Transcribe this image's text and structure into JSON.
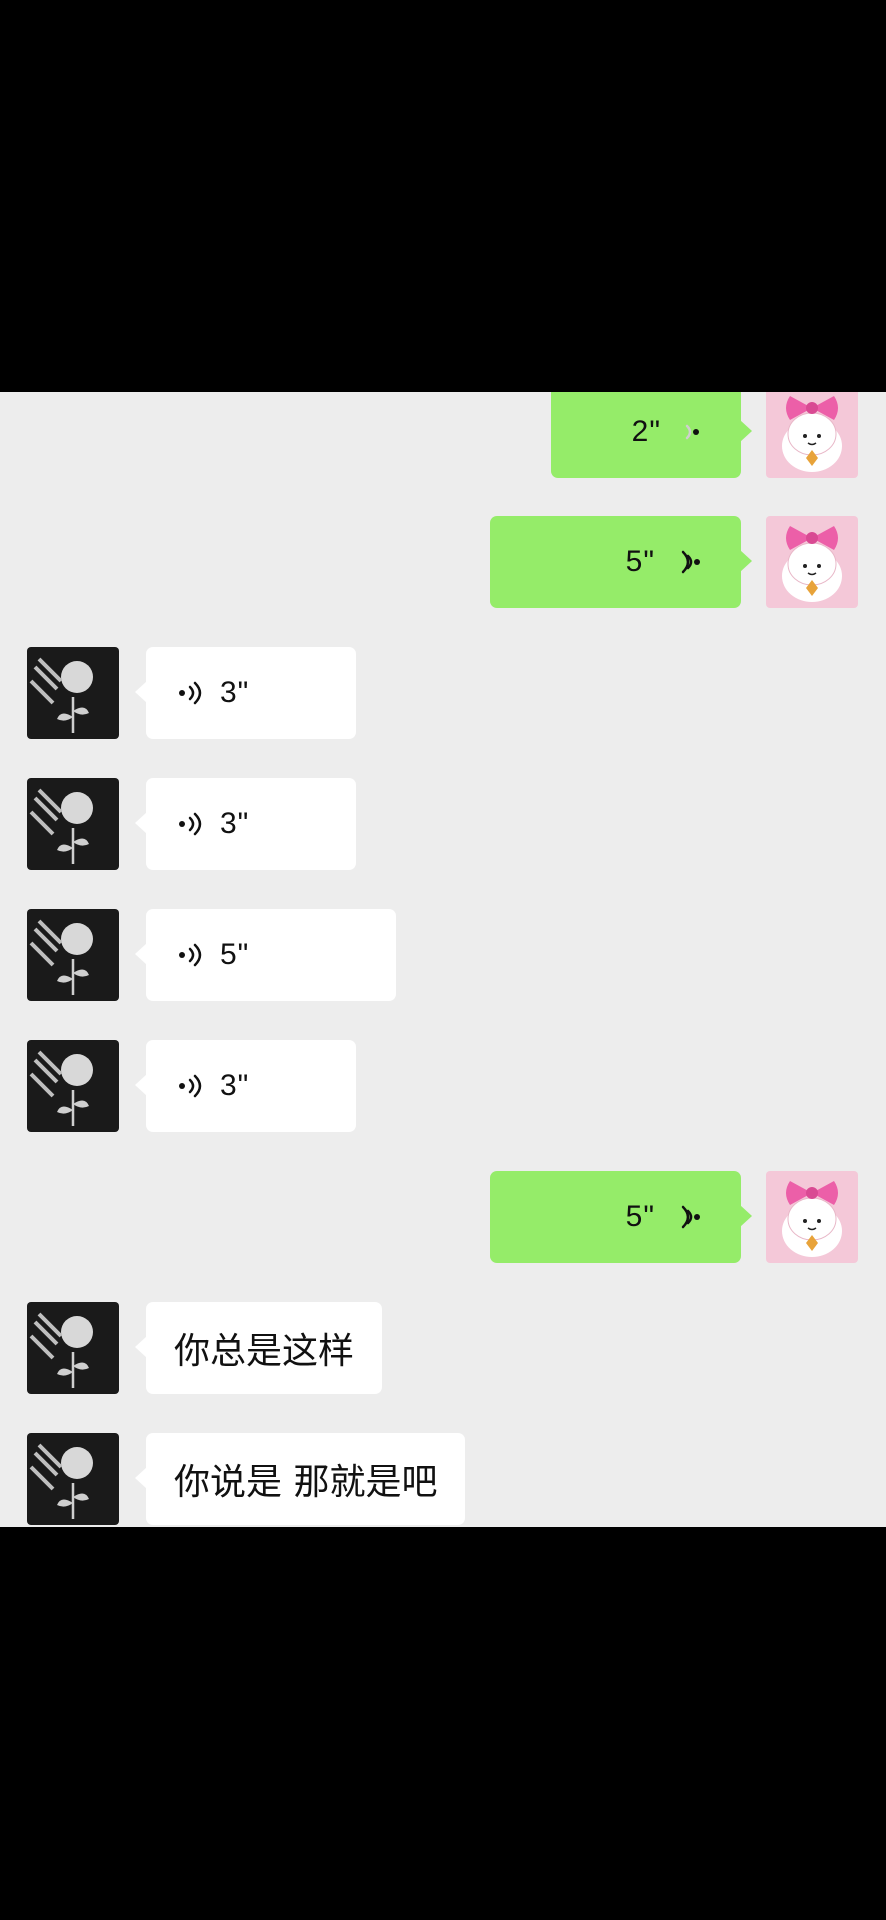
{
  "icons": {
    "self_avatar": "pink-bow-character-avatar",
    "contact_avatar": "dark-flower-avatar",
    "voice_sent": "voice-wave-right-icon",
    "voice_received": "voice-wave-left-icon"
  },
  "colors": {
    "sent_bubble": "#95ec69",
    "received_bubble": "#ffffff",
    "chat_background": "#ededed"
  },
  "messages": [
    {
      "sender": "me",
      "kind": "voice",
      "duration": "2\""
    },
    {
      "sender": "me",
      "kind": "voice",
      "duration": "5\""
    },
    {
      "sender": "contact",
      "kind": "voice",
      "duration": "3\""
    },
    {
      "sender": "contact",
      "kind": "voice",
      "duration": "3\""
    },
    {
      "sender": "contact",
      "kind": "voice",
      "duration": "5\""
    },
    {
      "sender": "contact",
      "kind": "voice",
      "duration": "3\""
    },
    {
      "sender": "me",
      "kind": "voice",
      "duration": "5\""
    },
    {
      "sender": "contact",
      "kind": "text",
      "text": "你总是这样"
    },
    {
      "sender": "contact",
      "kind": "text",
      "text": "你说是 那就是吧"
    }
  ]
}
